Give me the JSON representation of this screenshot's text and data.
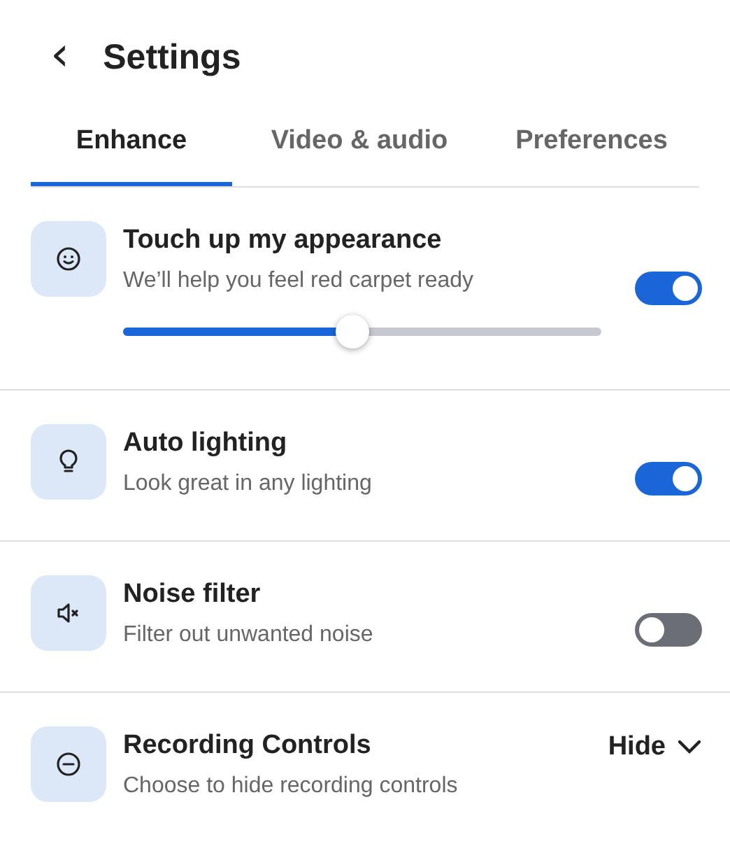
{
  "header": {
    "back": "‹",
    "title": "Settings"
  },
  "tabs": [
    {
      "label": "Enhance",
      "selected": true
    },
    {
      "label": "Video & audio",
      "selected": false
    },
    {
      "label": "Preferences",
      "selected": false
    }
  ],
  "settings": [
    {
      "kind": "slider",
      "title": "Touch up my appearance",
      "subtitle": "We’ll help you feel red carpet ready",
      "on": true,
      "level": 0.48
    },
    {
      "kind": "toggle",
      "title": "Auto lighting",
      "subtitle": "Look great in any lighting",
      "on": true
    },
    {
      "kind": "toggle",
      "title": "Noise filter",
      "subtitle": "Filter out unwanted noise",
      "on": false
    },
    {
      "kind": "dropdown",
      "title": "Recording Controls",
      "subtitle": "Choose to hide recording controls",
      "value": "Hide"
    }
  ]
}
